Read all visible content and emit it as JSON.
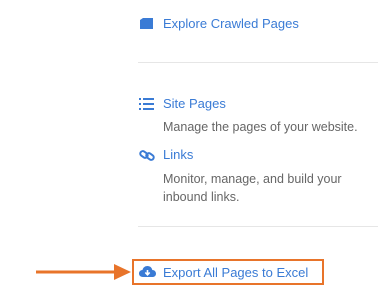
{
  "links": {
    "explore_label": "Explore Crawled Pages",
    "site_pages_label": "Site Pages",
    "site_pages_desc": "Manage the pages of your website.",
    "links_label": "Links",
    "links_desc_line1": "Monitor, manage, and build your",
    "links_desc_line2": "inbound links.",
    "export_label": "Export All Pages to Excel"
  },
  "icons": {
    "explore": "folder-icon",
    "site_pages": "list-icon",
    "links": "chain-link-icon",
    "export": "cloud-download-icon"
  },
  "colors": {
    "link": "#3a7bd5",
    "desc": "#666666",
    "highlight": "#e8742a"
  }
}
